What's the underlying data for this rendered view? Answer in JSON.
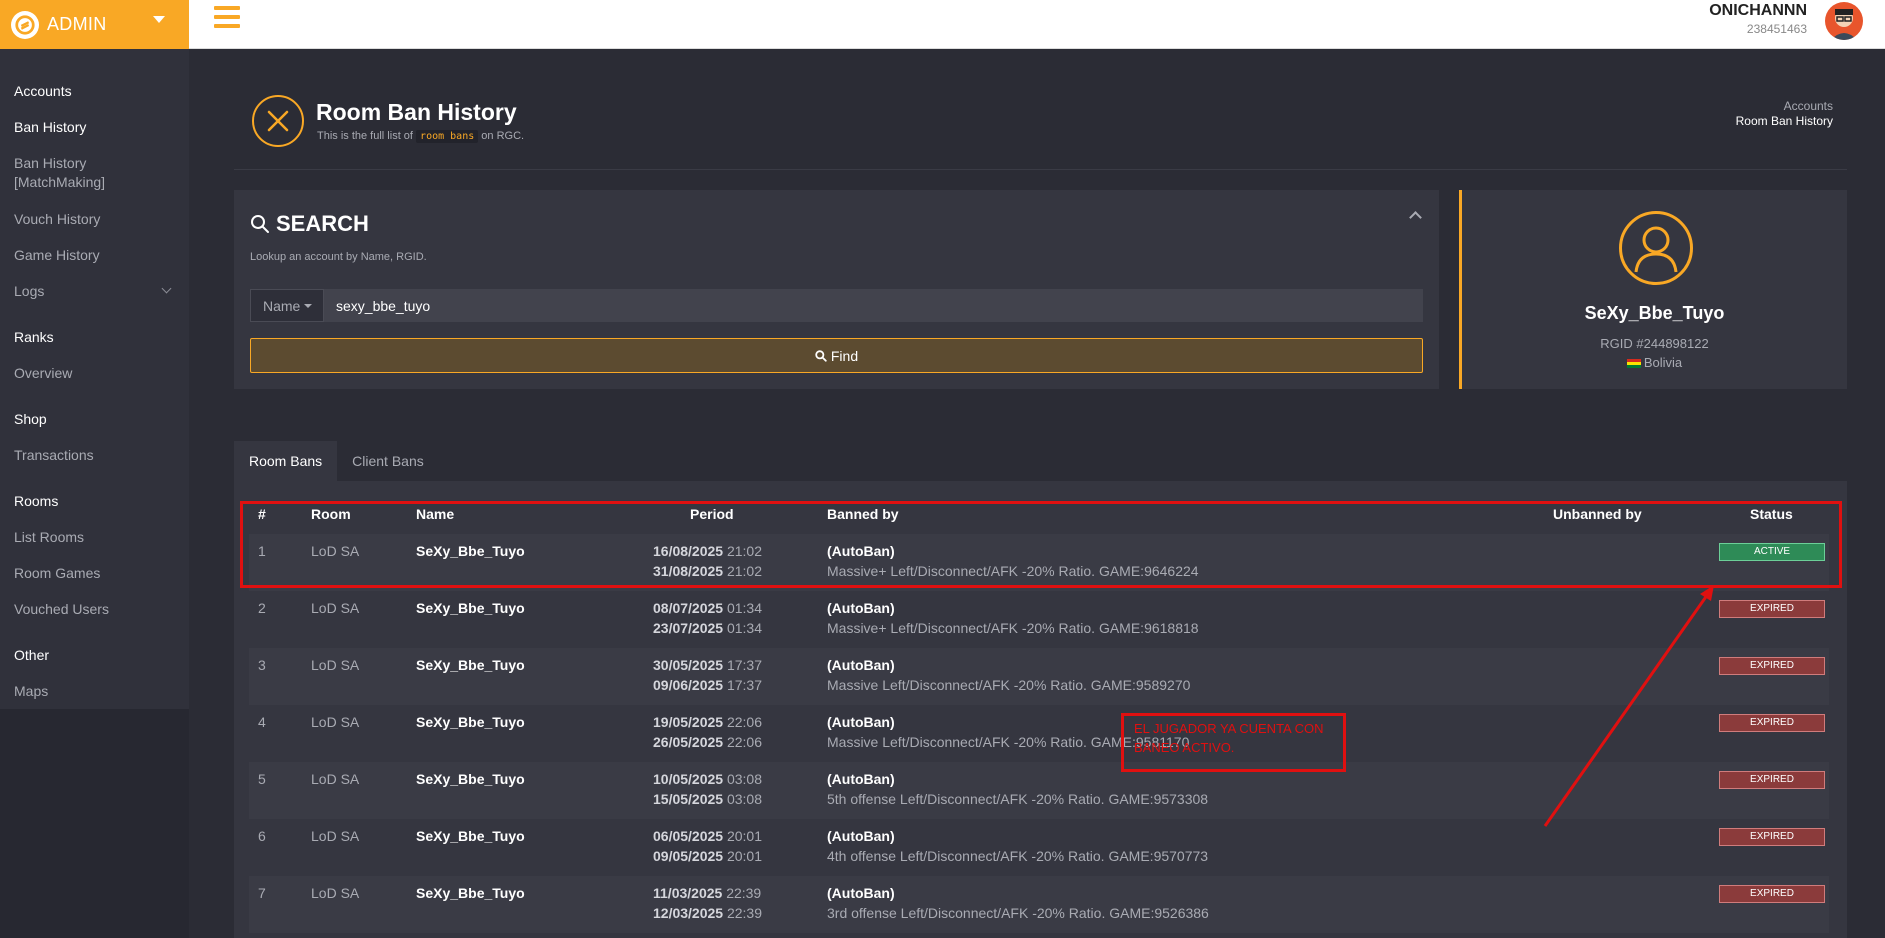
{
  "brand": {
    "name": "ADMIN"
  },
  "user": {
    "name": "ONICHANNN",
    "id": "238451463"
  },
  "sidebar": {
    "sections": [
      {
        "label": "Accounts"
      },
      {
        "label": "Ranks"
      },
      {
        "label": "Shop"
      },
      {
        "label": "Rooms"
      },
      {
        "label": "Other"
      }
    ],
    "items": [
      {
        "label": "Ban History"
      },
      {
        "label": "Ban History"
      },
      {
        "label": "[MatchMaking]"
      },
      {
        "label": "Vouch History"
      },
      {
        "label": "Game History"
      },
      {
        "label": "Logs"
      },
      {
        "label": "Overview"
      },
      {
        "label": "Transactions"
      },
      {
        "label": "List Rooms"
      },
      {
        "label": "Room Games"
      },
      {
        "label": "Vouched Users"
      },
      {
        "label": "Maps"
      }
    ]
  },
  "header": {
    "title": "Room Ban History",
    "subtitle_pre": "This is the full list of",
    "subtitle_code": "room bans",
    "subtitle_post": "on RGC.",
    "breadcrumb": [
      "Accounts",
      "Room Ban History"
    ]
  },
  "search": {
    "title": "SEARCH",
    "hint": "Lookup an account by Name, RGID.",
    "selector": "Name",
    "value": "sexy_bbe_tuyo",
    "find_label": "Find"
  },
  "profile": {
    "name": "SeXy_Bbe_Tuyo",
    "rgid": "RGID #244898122",
    "country": "Bolivia"
  },
  "tabs": [
    {
      "label": "Room Bans",
      "active": true
    },
    {
      "label": "Client Bans",
      "active": false
    }
  ],
  "table": {
    "headers": [
      "#",
      "Room",
      "Name",
      "Period",
      "Banned by",
      "Unbanned by",
      "Status"
    ],
    "rows": [
      {
        "num": "1",
        "room": "LoD SA",
        "name": "SeXy_Bbe_Tuyo",
        "start_date": "16/08/2025",
        "start_time": "21:02",
        "end_date": "31/08/2025",
        "end_time": "21:02",
        "by": "(AutoBan)",
        "reason": "Massive+ Left/Disconnect/AFK -20% Ratio. GAME:9646224",
        "status": "ACTIVE"
      },
      {
        "num": "2",
        "room": "LoD SA",
        "name": "SeXy_Bbe_Tuyo",
        "start_date": "08/07/2025",
        "start_time": "01:34",
        "end_date": "23/07/2025",
        "end_time": "01:34",
        "by": "(AutoBan)",
        "reason": "Massive+ Left/Disconnect/AFK -20% Ratio. GAME:9618818",
        "status": "EXPIRED"
      },
      {
        "num": "3",
        "room": "LoD SA",
        "name": "SeXy_Bbe_Tuyo",
        "start_date": "30/05/2025",
        "start_time": "17:37",
        "end_date": "09/06/2025",
        "end_time": "17:37",
        "by": "(AutoBan)",
        "reason": "Massive Left/Disconnect/AFK -20% Ratio. GAME:9589270",
        "status": "EXPIRED"
      },
      {
        "num": "4",
        "room": "LoD SA",
        "name": "SeXy_Bbe_Tuyo",
        "start_date": "19/05/2025",
        "start_time": "22:06",
        "end_date": "26/05/2025",
        "end_time": "22:06",
        "by": "(AutoBan)",
        "reason": "Massive Left/Disconnect/AFK -20% Ratio. GAME:9581170",
        "status": "EXPIRED"
      },
      {
        "num": "5",
        "room": "LoD SA",
        "name": "SeXy_Bbe_Tuyo",
        "start_date": "10/05/2025",
        "start_time": "03:08",
        "end_date": "15/05/2025",
        "end_time": "03:08",
        "by": "(AutoBan)",
        "reason": "5th offense Left/Disconnect/AFK -20% Ratio. GAME:9573308",
        "status": "EXPIRED"
      },
      {
        "num": "6",
        "room": "LoD SA",
        "name": "SeXy_Bbe_Tuyo",
        "start_date": "06/05/2025",
        "start_time": "20:01",
        "end_date": "09/05/2025",
        "end_time": "20:01",
        "by": "(AutoBan)",
        "reason": "4th offense Left/Disconnect/AFK -20% Ratio. GAME:9570773",
        "status": "EXPIRED"
      },
      {
        "num": "7",
        "room": "LoD SA",
        "name": "SeXy_Bbe_Tuyo",
        "start_date": "11/03/2025",
        "start_time": "22:39",
        "end_date": "12/03/2025",
        "end_time": "22:39",
        "by": "(AutoBan)",
        "reason": "3rd offense Left/Disconnect/AFK -20% Ratio. GAME:9526386",
        "status": "EXPIRED"
      }
    ]
  },
  "annotation": {
    "text": "EL JUGADOR YA CUENTA CON BANEO ACTIVO."
  },
  "colors": {
    "accent": "#f9a825",
    "active": "#2e8b57",
    "expired": "#8b3b3b",
    "annotation": "#e01010"
  }
}
